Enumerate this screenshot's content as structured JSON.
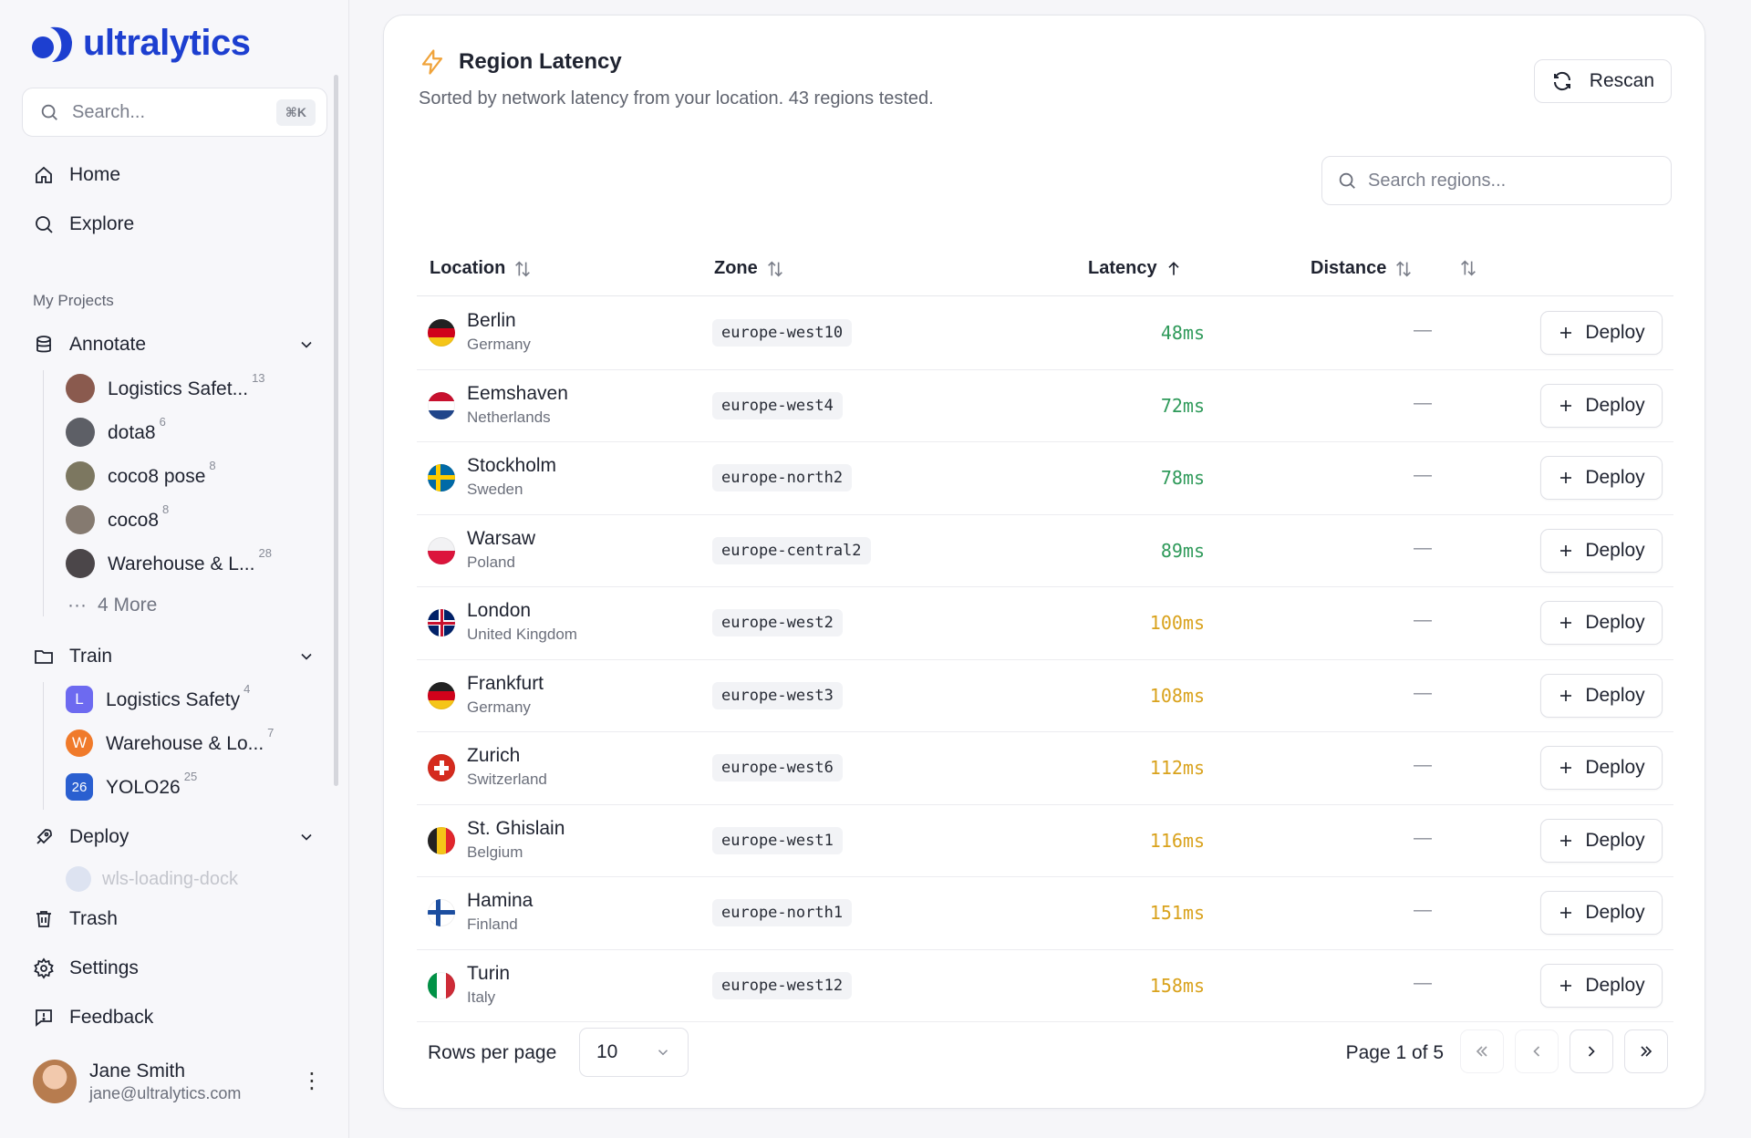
{
  "app": {
    "brand": "ultralytics"
  },
  "sidebar": {
    "search": {
      "placeholder": "Search...",
      "shortcut": "⌘K"
    },
    "nav": [
      {
        "label": "Home",
        "icon": "home-icon"
      },
      {
        "label": "Explore",
        "icon": "search-icon"
      }
    ],
    "section_label": "My Projects",
    "annotate": {
      "label": "Annotate",
      "items": [
        {
          "label": "Logistics Safet...",
          "count": "13"
        },
        {
          "label": "dota8",
          "count": "6"
        },
        {
          "label": "coco8 pose",
          "count": "8"
        },
        {
          "label": "coco8",
          "count": "8"
        },
        {
          "label": "Warehouse & L...",
          "count": "28"
        }
      ],
      "more": "4 More"
    },
    "train": {
      "label": "Train",
      "items": [
        {
          "badge": "L",
          "label": "Logistics Safety",
          "count": "4",
          "color": "#6d6af0"
        },
        {
          "badge": "W",
          "label": "Warehouse & Lo...",
          "count": "7",
          "color": "#f07a2a"
        },
        {
          "badge": "26",
          "label": "YOLO26",
          "count": "25",
          "color": "#2a5fd0"
        }
      ]
    },
    "deploy": {
      "label": "Deploy",
      "partial_item": "wls-loading-dock"
    },
    "bottom": [
      {
        "label": "Trash",
        "icon": "trash-icon"
      },
      {
        "label": "Settings",
        "icon": "gear-icon"
      },
      {
        "label": "Feedback",
        "icon": "feedback-icon"
      }
    ],
    "user": {
      "name": "Jane Smith",
      "email": "jane@ultralytics.com"
    }
  },
  "main": {
    "title": "Region Latency",
    "subtitle": "Sorted by network latency from your location. 43 regions tested.",
    "rescan_label": "Rescan",
    "region_search_placeholder": "Search regions...",
    "columns": {
      "location": "Location",
      "zone": "Zone",
      "latency": "Latency",
      "distance": "Distance"
    },
    "deploy_label": "Deploy",
    "rows": [
      {
        "city": "Berlin",
        "country": "Germany",
        "zone": "europe-west10",
        "latency": "48ms",
        "distance": "—",
        "flag": "de",
        "tier": "good"
      },
      {
        "city": "Eemshaven",
        "country": "Netherlands",
        "zone": "europe-west4",
        "latency": "72ms",
        "distance": "—",
        "flag": "nl",
        "tier": "good"
      },
      {
        "city": "Stockholm",
        "country": "Sweden",
        "zone": "europe-north2",
        "latency": "78ms",
        "distance": "—",
        "flag": "se",
        "tier": "good"
      },
      {
        "city": "Warsaw",
        "country": "Poland",
        "zone": "europe-central2",
        "latency": "89ms",
        "distance": "—",
        "flag": "pl",
        "tier": "good"
      },
      {
        "city": "London",
        "country": "United Kingdom",
        "zone": "europe-west2",
        "latency": "100ms",
        "distance": "—",
        "flag": "gb",
        "tier": "mid"
      },
      {
        "city": "Frankfurt",
        "country": "Germany",
        "zone": "europe-west3",
        "latency": "108ms",
        "distance": "—",
        "flag": "de",
        "tier": "mid"
      },
      {
        "city": "Zurich",
        "country": "Switzerland",
        "zone": "europe-west6",
        "latency": "112ms",
        "distance": "—",
        "flag": "ch",
        "tier": "mid"
      },
      {
        "city": "St. Ghislain",
        "country": "Belgium",
        "zone": "europe-west1",
        "latency": "116ms",
        "distance": "—",
        "flag": "be",
        "tier": "mid"
      },
      {
        "city": "Hamina",
        "country": "Finland",
        "zone": "europe-north1",
        "latency": "151ms",
        "distance": "—",
        "flag": "fi",
        "tier": "mid"
      },
      {
        "city": "Turin",
        "country": "Italy",
        "zone": "europe-west12",
        "latency": "158ms",
        "distance": "—",
        "flag": "it",
        "tier": "mid"
      }
    ],
    "pagination": {
      "rows_per_page_label": "Rows per page",
      "rows_per_page_value": "10",
      "page_info": "Page 1 of 5"
    },
    "colors": {
      "good": "#2f9a5a",
      "mid": "#d9a21c",
      "brand": "#1d3fd0"
    }
  }
}
